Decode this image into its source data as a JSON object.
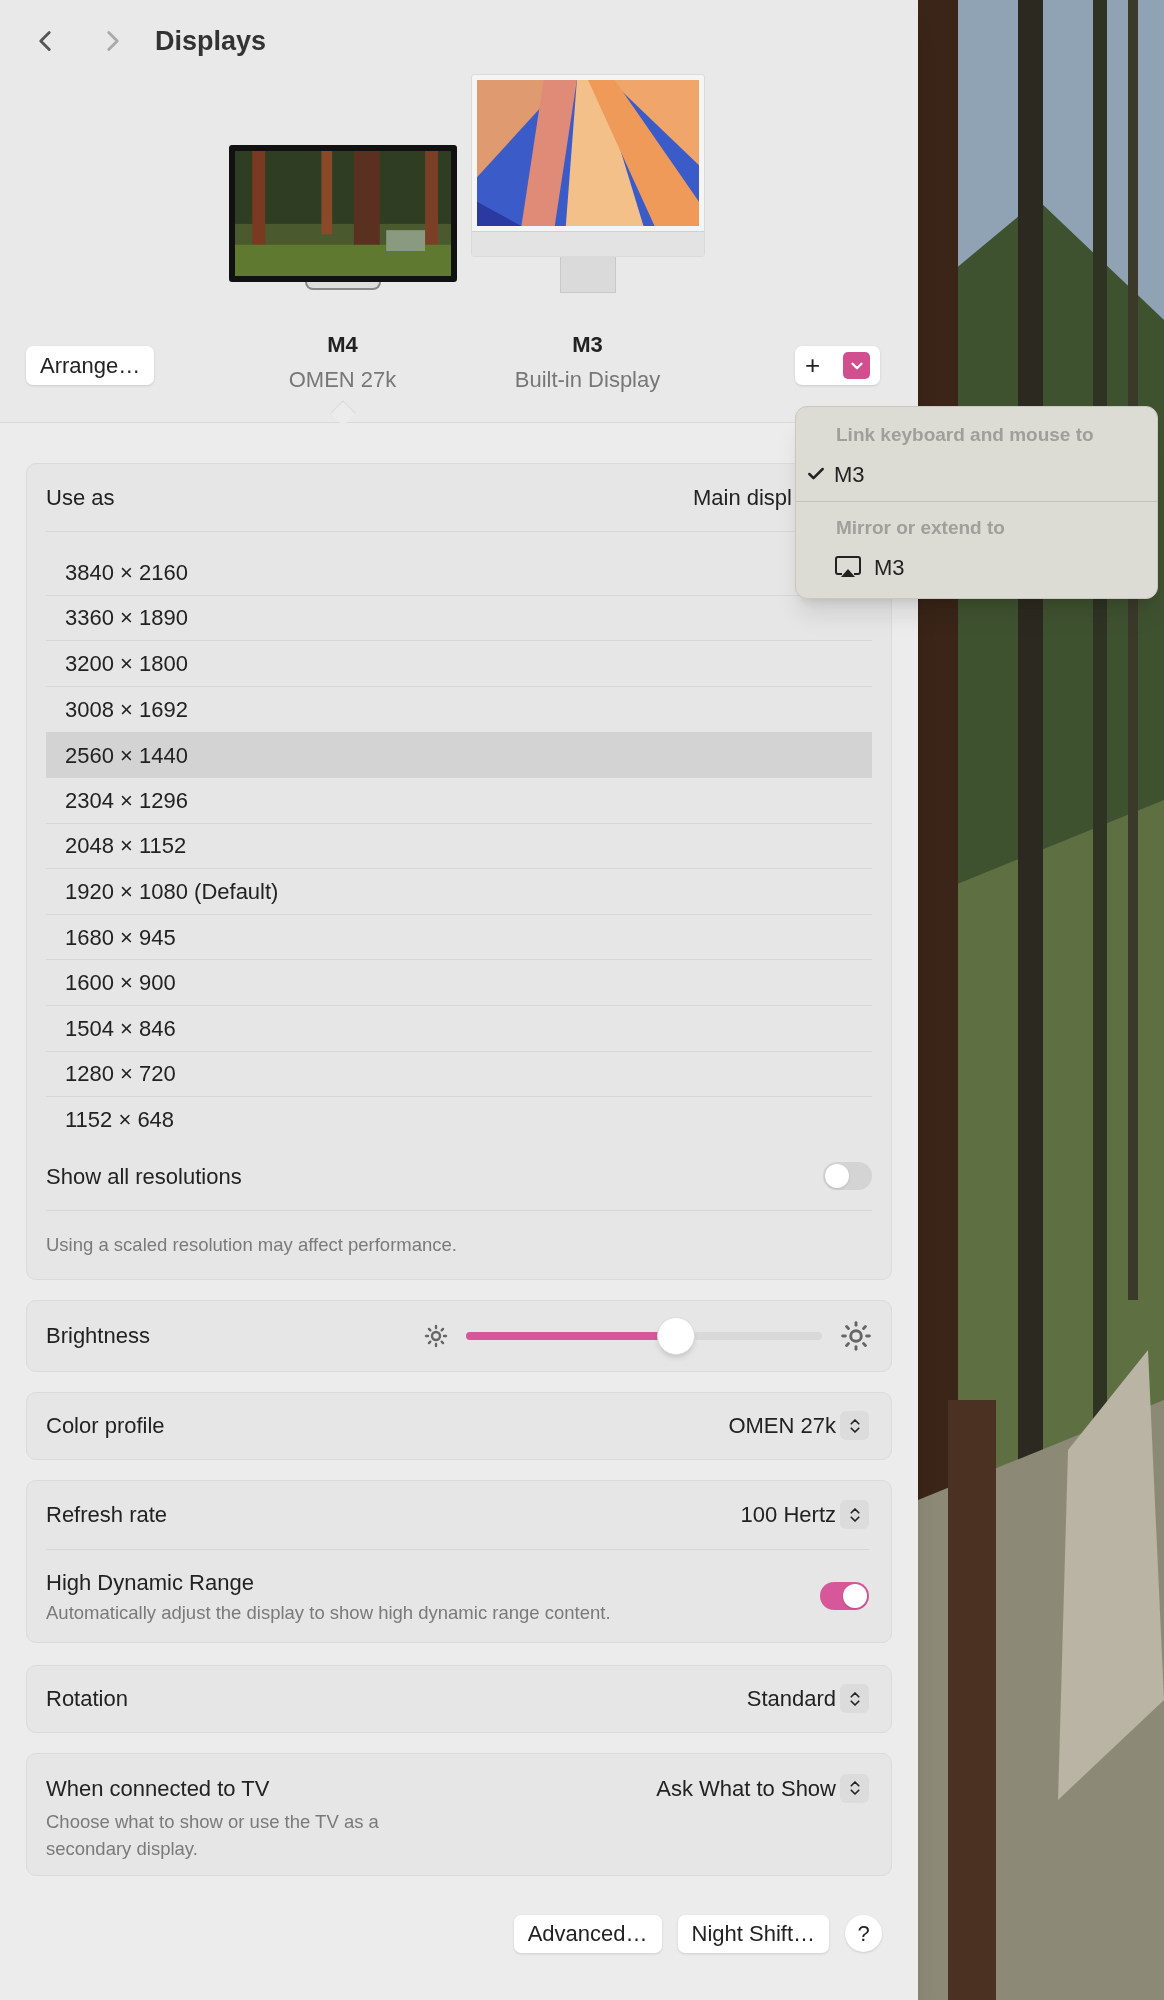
{
  "toolbar": {
    "title": "Displays"
  },
  "arrange_button": "Arrange…",
  "displays": [
    {
      "name": "M4",
      "subtitle": "OMEN 27k",
      "selected": true,
      "kind": "monitor"
    },
    {
      "name": "M3",
      "subtitle": "Built-in Display",
      "selected": false,
      "kind": "imac"
    }
  ],
  "add_button": {
    "label": "+"
  },
  "menu": {
    "sections": [
      {
        "header": "Link keyboard and mouse to",
        "items": [
          {
            "label": "M3",
            "kind": "check",
            "checked": true
          }
        ]
      },
      {
        "header": "Mirror or extend to",
        "items": [
          {
            "label": "M3",
            "kind": "airplay"
          }
        ]
      }
    ]
  },
  "use_as": {
    "label": "Use as",
    "value": "Main displ"
  },
  "resolutions": [
    {
      "label": "3840 × 2160",
      "selected": false
    },
    {
      "label": "3360 × 1890",
      "selected": false
    },
    {
      "label": "3200 × 1800",
      "selected": false
    },
    {
      "label": "3008 × 1692",
      "selected": false
    },
    {
      "label": "2560 × 1440",
      "selected": true
    },
    {
      "label": "2304 × 1296",
      "selected": false
    },
    {
      "label": "2048 × 1152",
      "selected": false
    },
    {
      "label": "1920 × 1080 (Default)",
      "selected": false
    },
    {
      "label": "1680 × 945",
      "selected": false
    },
    {
      "label": "1600 × 900",
      "selected": false
    },
    {
      "label": "1504 × 846",
      "selected": false
    },
    {
      "label": "1280 × 720",
      "selected": false
    },
    {
      "label": "1152 × 648",
      "selected": false
    }
  ],
  "show_all": {
    "label": "Show all resolutions",
    "on": false
  },
  "note": "Using a scaled resolution may affect performance.",
  "brightness": {
    "label": "Brightness",
    "level": 0.59
  },
  "color_profile": {
    "label": "Color profile",
    "value": "OMEN 27k"
  },
  "refresh_rate": {
    "label": "Refresh rate",
    "value": "100 Hertz"
  },
  "hdr": {
    "label": "High Dynamic Range",
    "description": "Automatically adjust the display to show high dynamic range content.",
    "on": true
  },
  "rotation": {
    "label": "Rotation",
    "value": "Standard"
  },
  "tv": {
    "label": "When connected to TV",
    "description": "Choose what to show or use the TV as a secondary display.",
    "value": "Ask What to Show"
  },
  "buttons": [
    "Advanced…",
    "Night Shift…"
  ],
  "help_button": "?"
}
